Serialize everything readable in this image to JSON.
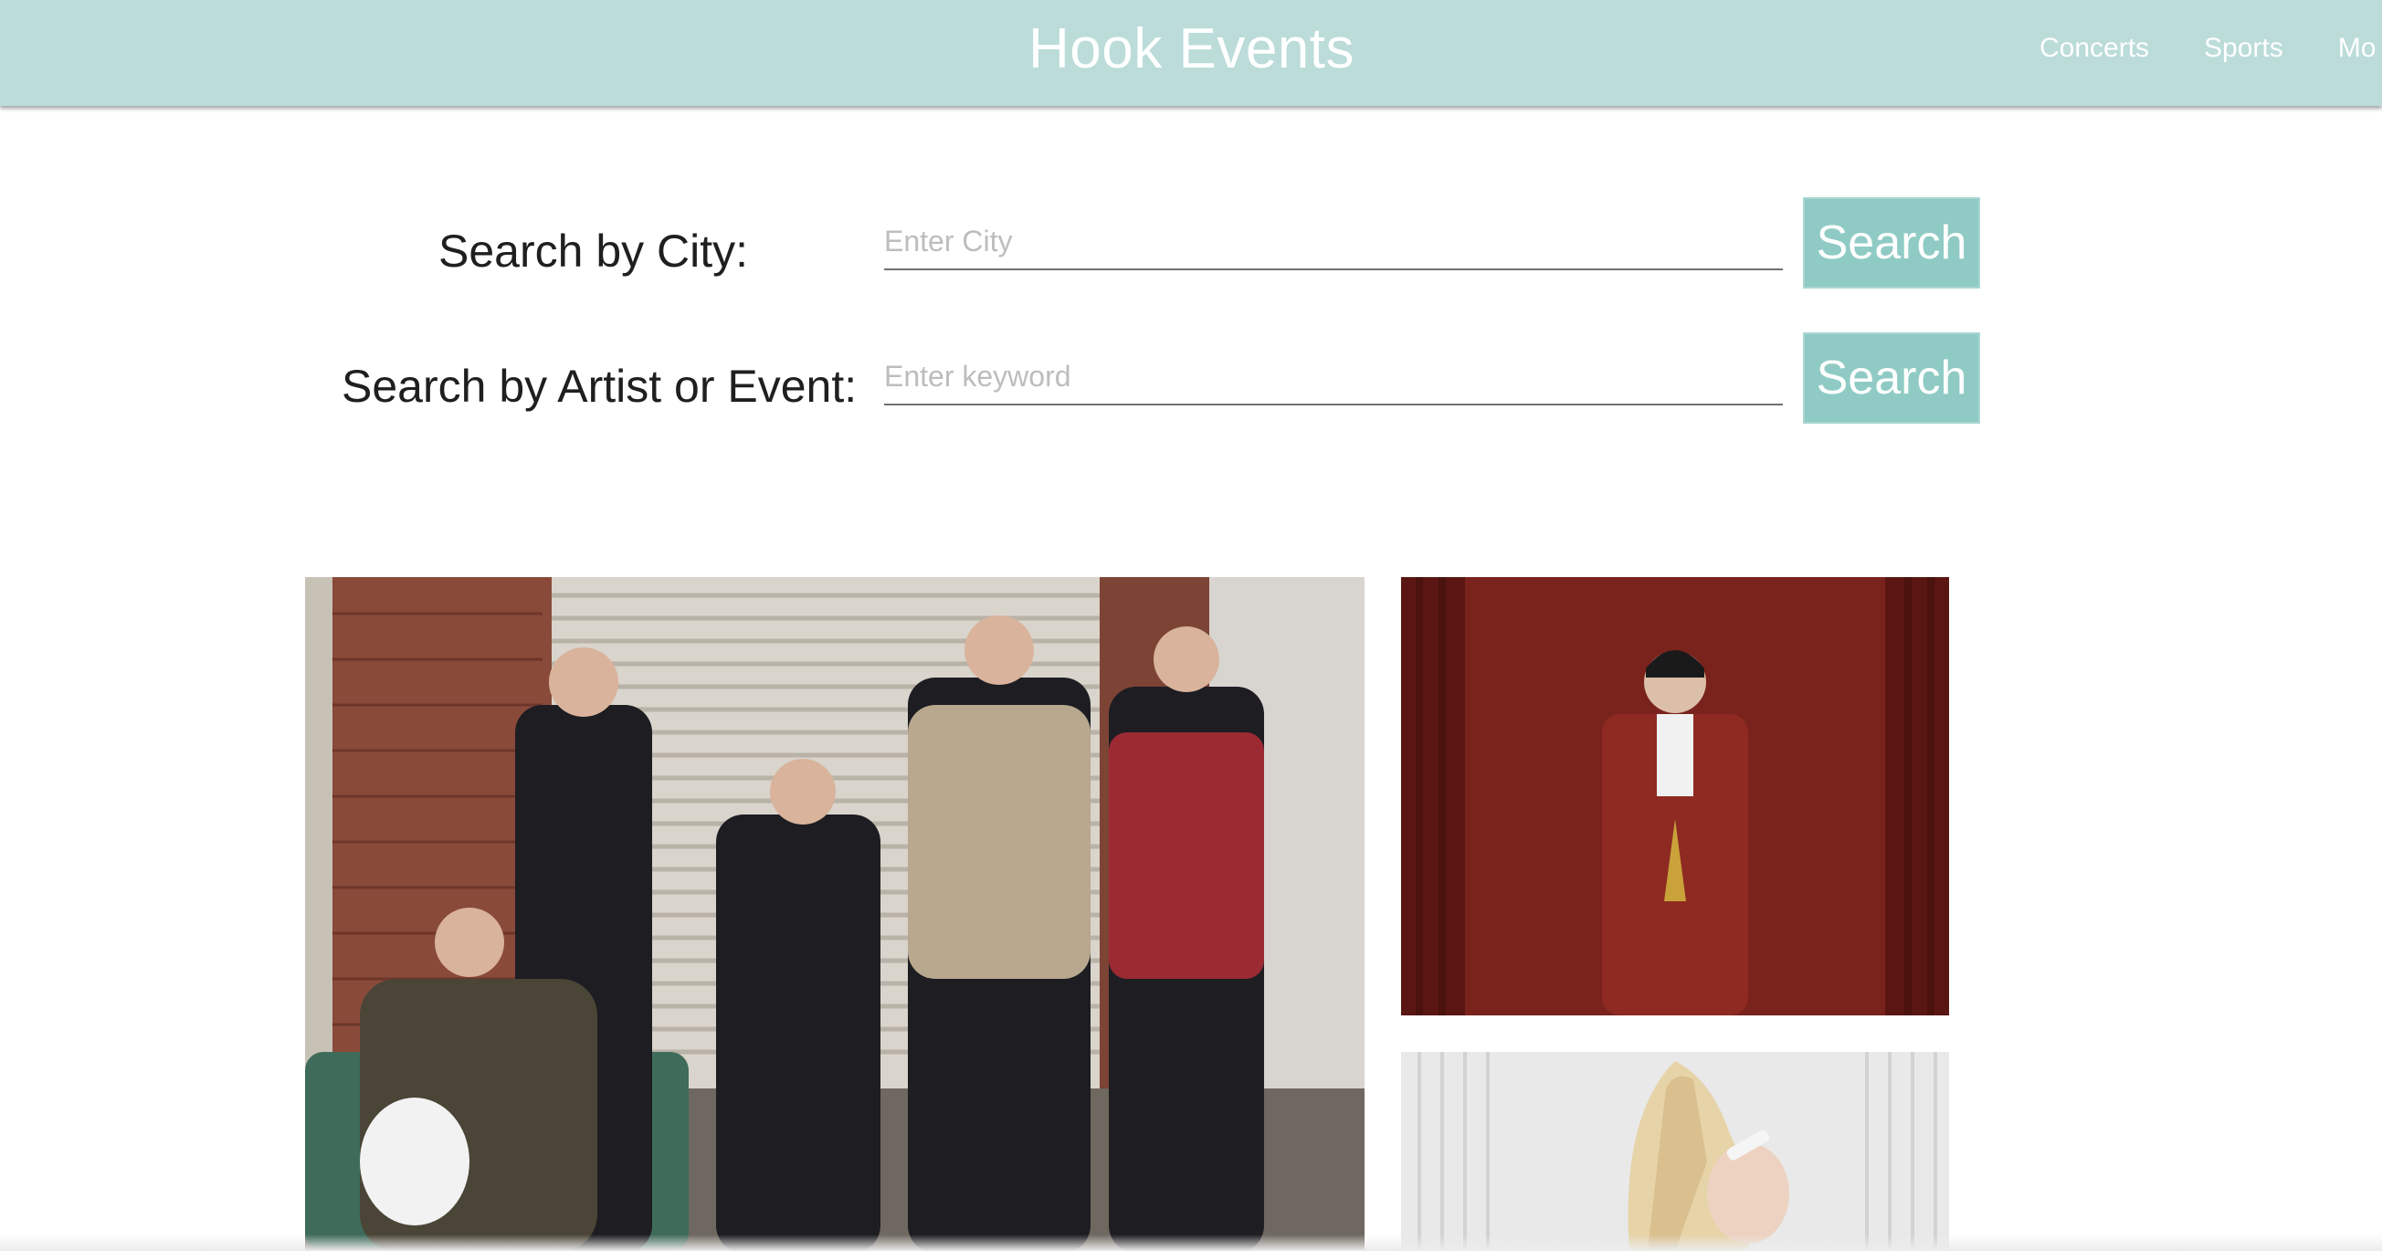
{
  "header": {
    "brand": "Hook Events",
    "nav": [
      "Concerts",
      "Sports",
      "Mo"
    ]
  },
  "search": {
    "city_label": "Search by City:",
    "city_placeholder": "Enter City",
    "city_value": "",
    "city_button": "Search",
    "keyword_label": "Search by Artist or Event:",
    "keyword_placeholder": "Enter keyword",
    "keyword_value": "",
    "keyword_button": "Search"
  },
  "colors": {
    "header_bg": "#bbdcd9",
    "button_bg": "#8fcbc4"
  }
}
